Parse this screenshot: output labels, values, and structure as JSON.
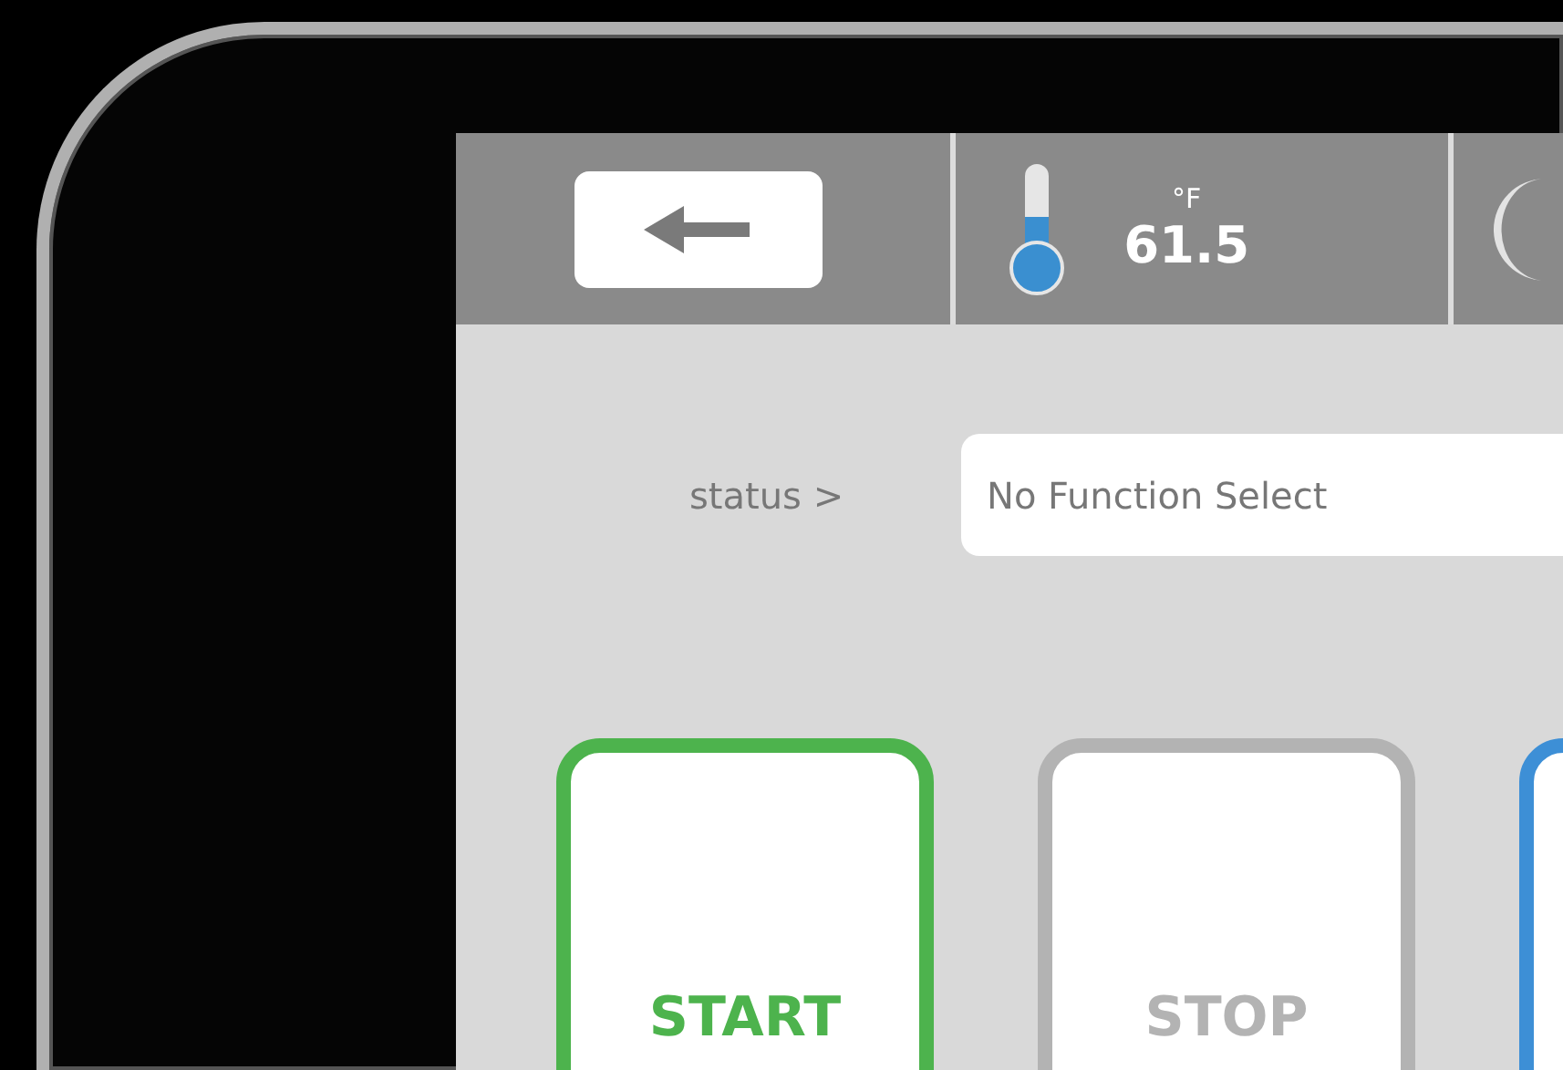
{
  "top_bar": {
    "temperature": {
      "unit": "°F",
      "value": "61.5"
    }
  },
  "status": {
    "label": "status >",
    "value": "No Function Select"
  },
  "buttons": [
    {
      "label": "START",
      "color": "#4db34d"
    },
    {
      "label": "STOP",
      "color": "#b3b3b3"
    },
    {
      "color": "#3d8fd6"
    }
  ]
}
